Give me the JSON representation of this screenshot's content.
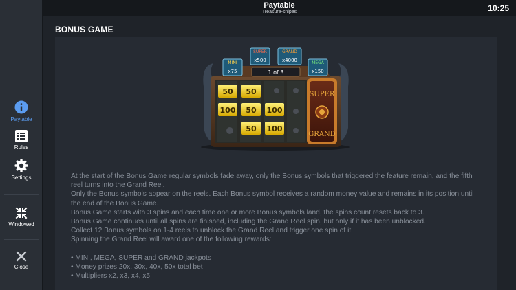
{
  "header": {
    "title": "Paytable",
    "subtitle": "Treasure-snipes",
    "clock": "10:25"
  },
  "sidebar": {
    "items": [
      {
        "label": "Paytable",
        "icon": "info-icon",
        "active": true
      },
      {
        "label": "Rules",
        "icon": "list-icon",
        "active": false
      },
      {
        "label": "Settings",
        "icon": "gear-icon",
        "active": false
      },
      {
        "label": "Windowed",
        "icon": "collapse-icon",
        "active": false
      },
      {
        "label": "Close",
        "icon": "close-icon",
        "active": false
      }
    ]
  },
  "section": {
    "title": "BONUS GAME"
  },
  "game_image": {
    "jackpots": [
      {
        "name": "MINI",
        "value": "x75"
      },
      {
        "name": "SUPER",
        "value": "x500"
      },
      {
        "name": "GRAND",
        "value": "x4000"
      },
      {
        "name": "MEGA",
        "value": "x150"
      }
    ],
    "counter": "1 of 3",
    "symbols": [
      [
        "50",
        "50"
      ],
      [
        "100",
        "50",
        "100"
      ],
      [
        "50",
        "100"
      ]
    ],
    "grand_reel": [
      "SUPER",
      "GRAND"
    ]
  },
  "description": {
    "paragraphs": [
      "At the start of the Bonus Game regular symbols fade away, only the Bonus symbols that triggered the feature remain, and the fifth reel turns into the Grand Reel.",
      "Only the Bonus symbols appear on the reels. Each Bonus symbol receives a random money value and remains in its position until the end of the Bonus Game.",
      "Bonus Game starts with 3 spins and each time one or more Bonus symbols land, the spins count resets back to 3.",
      "Bonus Game continues until all spins are finished, including the Grand Reel spin, but only if it has been unblocked.",
      "Collect 12 Bonus symbols on 1-4 reels to unblock the Grand Reel and trigger one spin of it.",
      "Spinning the Grand Reel will award one of the following rewards:"
    ],
    "bullets": [
      "• MINI, MEGA, SUPER and GRAND jackpots",
      "• Money prizes 20x, 30x, 40x, 50x total bet",
      "• Multipliers x2, x3, x4, x5"
    ]
  },
  "colors": {
    "background": "#1f2329",
    "panel": "#262b33",
    "sidebar": "#2a2f36",
    "accent": "#5b9cf0",
    "text_muted": "#878e98"
  }
}
